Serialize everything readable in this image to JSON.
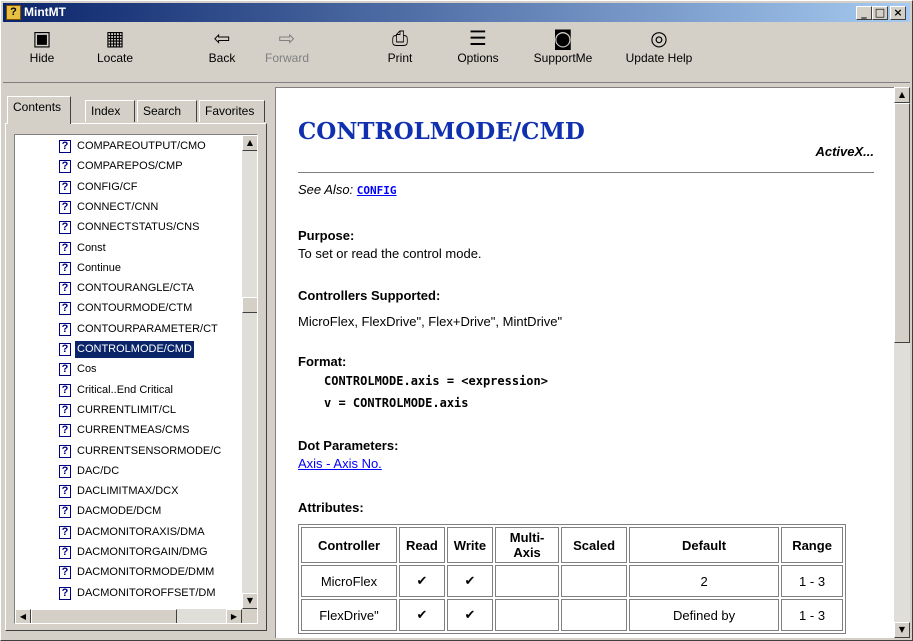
{
  "window": {
    "title": "MintMT"
  },
  "toolbar": [
    {
      "label": "Hide",
      "icon": "hide-icon",
      "glyph": "▣",
      "enabled": true
    },
    {
      "label": "Locate",
      "icon": "locate-icon",
      "glyph": "▦",
      "enabled": true
    },
    {
      "label": "Back",
      "icon": "back-arrow-icon",
      "glyph": "⇦",
      "enabled": true
    },
    {
      "label": "Forward",
      "icon": "forward-arrow-icon",
      "glyph": "⇨",
      "enabled": false
    },
    {
      "label": "Print",
      "icon": "print-icon",
      "glyph": "⎙",
      "enabled": true
    },
    {
      "label": "Options",
      "icon": "options-icon",
      "glyph": "☰",
      "enabled": true
    },
    {
      "label": "SupportMe",
      "icon": "supportme-icon",
      "glyph": "◙",
      "enabled": true
    },
    {
      "label": "Update Help",
      "icon": "update-help-icon",
      "glyph": "◎",
      "enabled": true
    }
  ],
  "tabs": [
    "Contents",
    "Index",
    "Search",
    "Favorites"
  ],
  "active_tab": "Contents",
  "tree_items": [
    "COMPAREOUTPUT/CMO",
    "COMPAREPOS/CMP",
    "CONFIG/CF",
    "CONNECT/CNN",
    "CONNECTSTATUS/CNS",
    "Const",
    "Continue",
    "CONTOURANGLE/CTA",
    "CONTOURMODE/CTM",
    "CONTOURPARAMETER/CT",
    "CONTROLMODE/CMD",
    "Cos",
    "Critical..End Critical",
    "CURRENTLIMIT/CL",
    "CURRENTMEAS/CMS",
    "CURRENTSENSORMODE/C",
    "DAC/DC",
    "DACLIMITMAX/DCX",
    "DACMODE/DCM",
    "DACMONITORAXIS/DMA",
    "DACMONITORGAIN/DMG",
    "DACMONITORMODE/DMM",
    "DACMONITOROFFSET/DM"
  ],
  "selected_item": "CONTROLMODE/CMD",
  "page": {
    "heading": "CONTROLMODE/CMD",
    "activex": "ActiveX...",
    "see_also_label": "See Also:",
    "see_also_link": "CONFIG",
    "purpose_title": "Purpose:",
    "purpose_text": "To set or read the control mode.",
    "controllers_title": "Controllers Supported:",
    "controllers_text": "MicroFlex, FlexDrive\", Flex+Drive\", MintDrive\"",
    "format_title": "Format:",
    "format_line1": "CONTROLMODE.axis = <expression>",
    "format_line2": "v = CONTROLMODE.axis",
    "dot_title": "Dot Parameters:",
    "dot_link": "Axis - Axis No.",
    "attributes_title": "Attributes:",
    "table_headers": [
      "Controller",
      "Read",
      "Write",
      "Multi-Axis",
      "Scaled",
      "Default",
      "Range"
    ],
    "table_rows": [
      [
        "MicroFlex",
        "✔",
        "✔",
        "",
        "",
        "2",
        "1 - 3"
      ],
      [
        "FlexDrive\"",
        "✔",
        "✔",
        "",
        "",
        "Defined by",
        "1 - 3"
      ]
    ]
  }
}
